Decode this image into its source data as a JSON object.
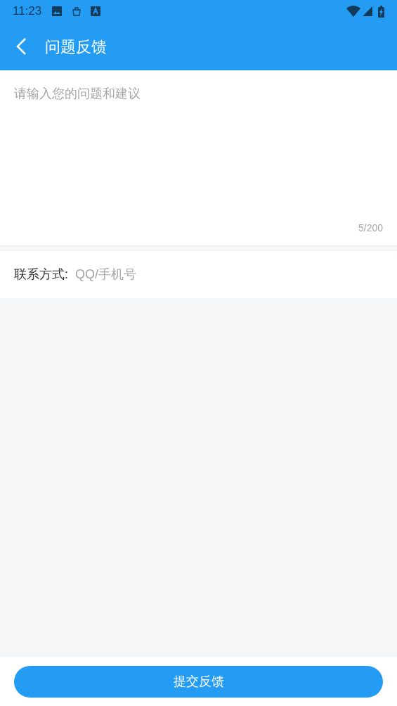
{
  "status_bar": {
    "time": "11:23"
  },
  "header": {
    "title": "问题反馈"
  },
  "feedback": {
    "placeholder": "请输入您的问题和建议",
    "counter": "5/200"
  },
  "contact": {
    "label": "联系方式:",
    "placeholder": "QQ/手机号"
  },
  "submit_button": "提交反馈"
}
